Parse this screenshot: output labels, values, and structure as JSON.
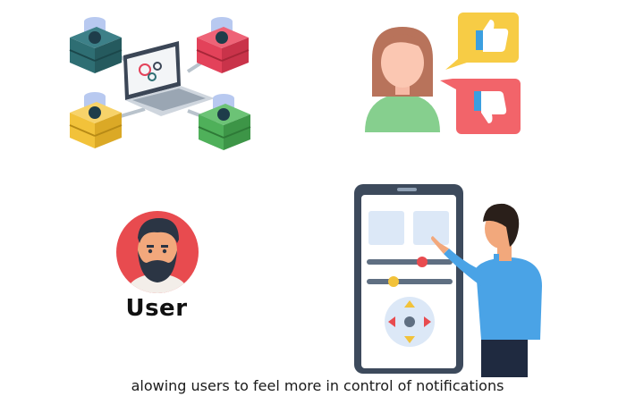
{
  "illustrations": {
    "servers_icon": "server-network-icon",
    "feedback_icon": "feedback-thumbs-icon",
    "phone_icon": "phone-controls-icon",
    "avatar_icon": "user-avatar-icon"
  },
  "user": {
    "label": "User"
  },
  "caption": {
    "text": "alowing users to feel more in control of notifications"
  },
  "colors": {
    "server_teal": "#2e6e73",
    "server_red": "#e3425a",
    "server_yellow": "#f2c23a",
    "server_green": "#4fb05a",
    "like_yellow": "#f7cc45",
    "dislike_red": "#f2646a",
    "person_green": "#86cf8e",
    "avatar_red": "#e84b4f",
    "phone_frame": "#3d4a5c",
    "shirt_blue": "#4aa3e6"
  }
}
